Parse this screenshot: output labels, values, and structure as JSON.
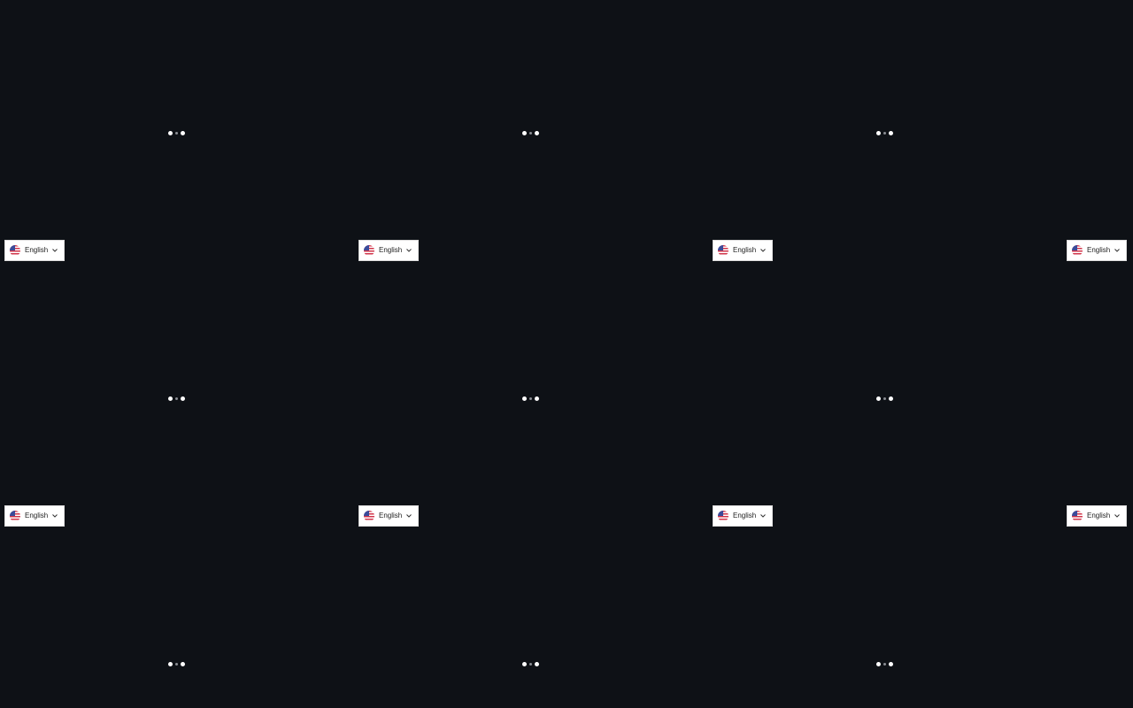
{
  "language_selector": {
    "label": "English",
    "flag_icon": "us-flag-icon",
    "dropdown_icon": "chevron-down-icon"
  },
  "loader_icon": "loading-dots-icon",
  "colors": {
    "background": "#0e1116",
    "selector_background": "#ffffff",
    "dot": "#ffffff",
    "dot_dim": "#8a8d93"
  }
}
